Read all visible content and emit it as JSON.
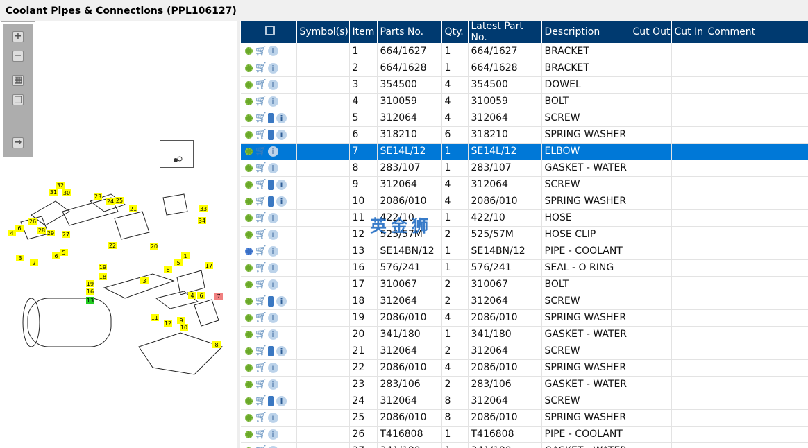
{
  "title": "Coolant Pipes & Connections (PPL106127)",
  "watermark": "英金狮",
  "headers": {
    "symbols": "Symbol(s)",
    "item": "Item",
    "parts_no": "Parts No.",
    "qty": "Qty.",
    "latest": "Latest Part No.",
    "description": "Description",
    "cut_out": "Cut Out",
    "cut_in": "Cut In",
    "comment": "Comment"
  },
  "selected_item": "7",
  "rows": [
    {
      "item": "1",
      "part": "664/1627",
      "qty": "1",
      "latest": "664/1627",
      "desc": "BRACKET",
      "book": false
    },
    {
      "item": "2",
      "part": "664/1628",
      "qty": "1",
      "latest": "664/1628",
      "desc": "BRACKET",
      "book": false
    },
    {
      "item": "3",
      "part": "354500",
      "qty": "4",
      "latest": "354500",
      "desc": "DOWEL",
      "book": false
    },
    {
      "item": "4",
      "part": "310059",
      "qty": "4",
      "latest": "310059",
      "desc": "BOLT",
      "book": false
    },
    {
      "item": "5",
      "part": "312064",
      "qty": "4",
      "latest": "312064",
      "desc": "SCREW",
      "book": true
    },
    {
      "item": "6",
      "part": "318210",
      "qty": "6",
      "latest": "318210",
      "desc": "SPRING WASHER",
      "book": true
    },
    {
      "item": "7",
      "part": "SE14L/12",
      "qty": "1",
      "latest": "SE14L/12",
      "desc": "ELBOW",
      "book": false
    },
    {
      "item": "8",
      "part": "283/107",
      "qty": "1",
      "latest": "283/107",
      "desc": "GASKET - WATER OUTLET",
      "book": false
    },
    {
      "item": "9",
      "part": "312064",
      "qty": "4",
      "latest": "312064",
      "desc": "SCREW",
      "book": true
    },
    {
      "item": "10",
      "part": "2086/010",
      "qty": "4",
      "latest": "2086/010",
      "desc": "SPRING WASHER",
      "book": true
    },
    {
      "item": "11",
      "part": "422/10",
      "qty": "1",
      "latest": "422/10",
      "desc": "HOSE",
      "book": false
    },
    {
      "item": "12",
      "part": "525/57M",
      "qty": "2",
      "latest": "525/57M",
      "desc": "HOSE CLIP",
      "book": false
    },
    {
      "item": "13",
      "part": "SE14BN/12",
      "qty": "1",
      "latest": "SE14BN/12",
      "desc": "PIPE - COOLANT",
      "book": false,
      "assembly": true
    },
    {
      "item": "16",
      "part": "576/241",
      "qty": "1",
      "latest": "576/241",
      "desc": "SEAL - O RING",
      "book": false
    },
    {
      "item": "17",
      "part": "310067",
      "qty": "2",
      "latest": "310067",
      "desc": "BOLT",
      "book": false
    },
    {
      "item": "18",
      "part": "312064",
      "qty": "2",
      "latest": "312064",
      "desc": "SCREW",
      "book": true
    },
    {
      "item": "19",
      "part": "2086/010",
      "qty": "4",
      "latest": "2086/010",
      "desc": "SPRING WASHER",
      "book": false
    },
    {
      "item": "20",
      "part": "341/180",
      "qty": "1",
      "latest": "341/180",
      "desc": "GASKET - WATER OUTLET",
      "book": false
    },
    {
      "item": "21",
      "part": "312064",
      "qty": "2",
      "latest": "312064",
      "desc": "SCREW",
      "book": true
    },
    {
      "item": "22",
      "part": "2086/010",
      "qty": "4",
      "latest": "2086/010",
      "desc": "SPRING WASHER",
      "book": false
    },
    {
      "item": "23",
      "part": "283/106",
      "qty": "2",
      "latest": "283/106",
      "desc": "GASKET - WATER OUTLET",
      "book": false
    },
    {
      "item": "24",
      "part": "312064",
      "qty": "8",
      "latest": "312064",
      "desc": "SCREW",
      "book": true
    },
    {
      "item": "25",
      "part": "2086/010",
      "qty": "8",
      "latest": "2086/010",
      "desc": "SPRING WASHER",
      "book": false
    },
    {
      "item": "26",
      "part": "T416808",
      "qty": "1",
      "latest": "T416808",
      "desc": "PIPE - COOLANT",
      "book": false
    },
    {
      "item": "27",
      "part": "341/180",
      "qty": "1",
      "latest": "341/180",
      "desc": "GASKET - WATER OUTLET",
      "book": false
    }
  ],
  "callouts": [
    "32",
    "31",
    "30",
    "23",
    "24",
    "25",
    "21",
    "33",
    "34",
    "26",
    "28",
    "29",
    "27",
    "22",
    "20",
    "4",
    "6",
    "3",
    "2",
    "6",
    "5",
    "1",
    "17",
    "19",
    "18",
    "19",
    "16",
    "13",
    "3",
    "6",
    "5",
    "4",
    "6",
    "7",
    "11",
    "12",
    "9",
    "10",
    "8"
  ]
}
